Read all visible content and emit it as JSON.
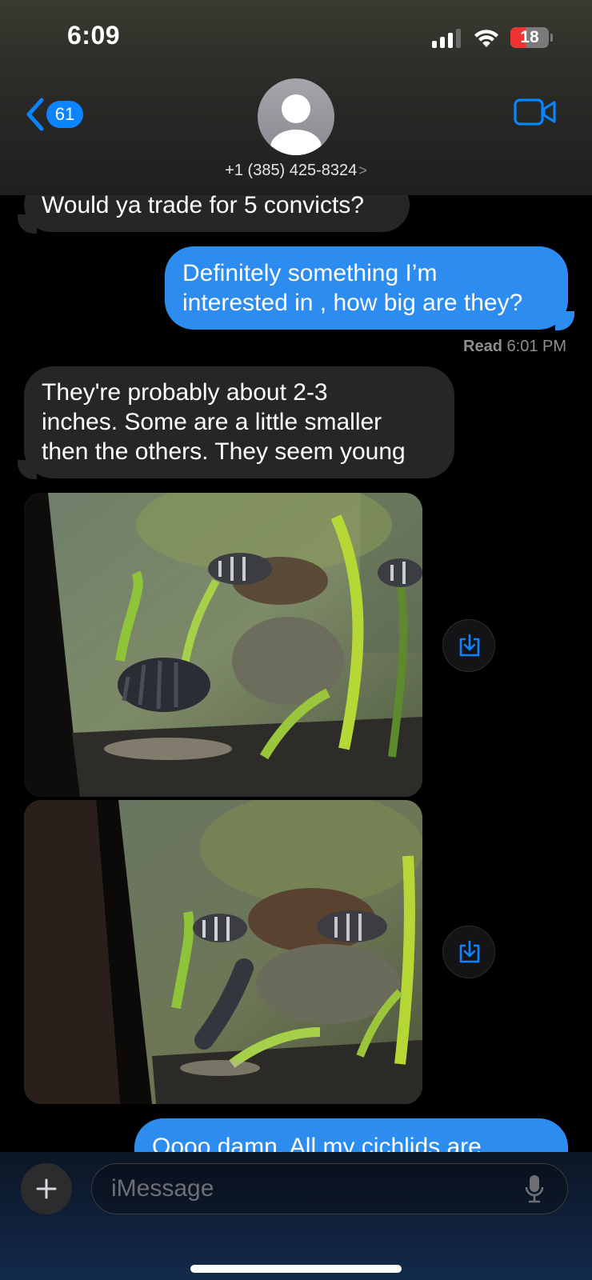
{
  "status_bar": {
    "time": "6:09",
    "battery": "18"
  },
  "header": {
    "unread_count": "61",
    "contact_number": "+1 (385) 425-8324",
    "contact_chevron": ">"
  },
  "messages": [
    {
      "direction": "incoming",
      "text": "Would ya trade for 5 convicts?"
    },
    {
      "direction": "outgoing",
      "lines": [
        "Definitely something I’m",
        "interested in , how big are they?"
      ]
    },
    {
      "direction": "incoming",
      "lines": [
        "They're probably about 2-3",
        "inches. Some are a little smaller",
        "then the others. They seem young"
      ]
    },
    {
      "direction": "incoming",
      "type": "photo"
    },
    {
      "direction": "incoming",
      "type": "photo"
    },
    {
      "direction": "outgoing",
      "text": "Oooo damn. All my cichlids are"
    }
  ],
  "read_receipt": {
    "label": "Read",
    "time": "6:01 PM"
  },
  "composer": {
    "placeholder": "iMessage"
  },
  "icons": {
    "back": "chevron-left-icon",
    "video": "video-camera-icon",
    "save": "download-icon",
    "add": "plus-icon",
    "mic": "microphone-icon"
  },
  "colors": {
    "accent": "#0a84ff",
    "outgoing_bubble": "#2d8cf0",
    "incoming_bubble": "#262628",
    "battery_low": "#ee3333"
  }
}
